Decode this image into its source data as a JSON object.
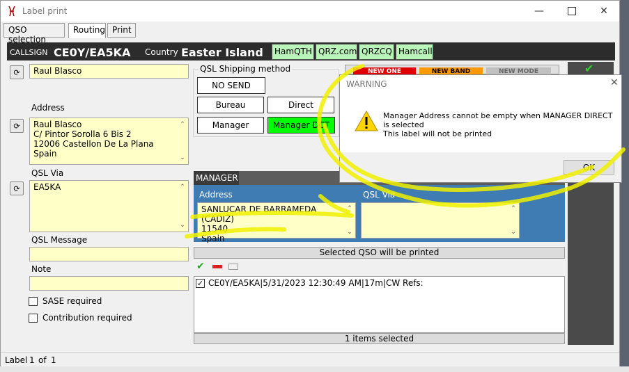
{
  "window": {
    "title": "Label print"
  },
  "tabs": [
    {
      "label": "QSO selection"
    },
    {
      "label": "Routing"
    },
    {
      "label": "Print"
    }
  ],
  "header": {
    "callsign_label": "CALLSIGN",
    "callsign": "CE0Y/EA5KA",
    "country_label": "Country",
    "country": "Easter Island",
    "links": [
      "HamQTH",
      "QRZ.com",
      "QRZCQ",
      "Hamcall"
    ]
  },
  "left": {
    "name": "Raul Blasco",
    "address_label": "Address",
    "address_lines": [
      "Raul Blasco",
      "C/ Pintor Sorolla 6 Bis 2",
      "12006 Castellon De La Plana",
      "Spain"
    ],
    "qsl_via_label": "QSL Via",
    "qsl_via": "EA5KA",
    "qsl_message_label": "QSL Message",
    "note_label": "Note",
    "sase_label": "SASE required",
    "contribution_label": "Contribution required"
  },
  "shipping": {
    "title": "QSL Shipping method",
    "no_send": "NO SEND",
    "bureau": "Bureau",
    "direct": "Direct",
    "manager": "Manager",
    "manager_dct": "Manager DCT"
  },
  "status_buttons": [
    "NEW ONE",
    "NEW BAND",
    "NEW MODE"
  ],
  "manager": {
    "title": "MANAGER",
    "address_label": "Address",
    "qsl_via_label": "QSL Via",
    "address_lines": [
      "SANLUCAR DE BARRAMEDA (CADIZ)",
      "11540",
      "Spain"
    ]
  },
  "qso_list": {
    "header": "Selected QSO will be printed",
    "items": [
      "CE0Y/EA5KA|5/31/2023 12:30:49 AM|17m|CW Refs:"
    ],
    "footer": "1 items selected"
  },
  "statusbar": {
    "label": "Label",
    "current": "1",
    "of": "of",
    "total": "1"
  },
  "dialog": {
    "title": "WARNING",
    "message_line1": "Manager Address cannot be empty when MANAGER DIRECT is selected",
    "message_line2": "This label will not be printed",
    "ok": "OK"
  },
  "colors": {
    "field_bg": "#ffffc8",
    "link_bg": "#b9f5b9",
    "manager_dct_bg": "#00ff00",
    "manager_panel": "#3f7cb3",
    "annotation": "#f0f000"
  }
}
